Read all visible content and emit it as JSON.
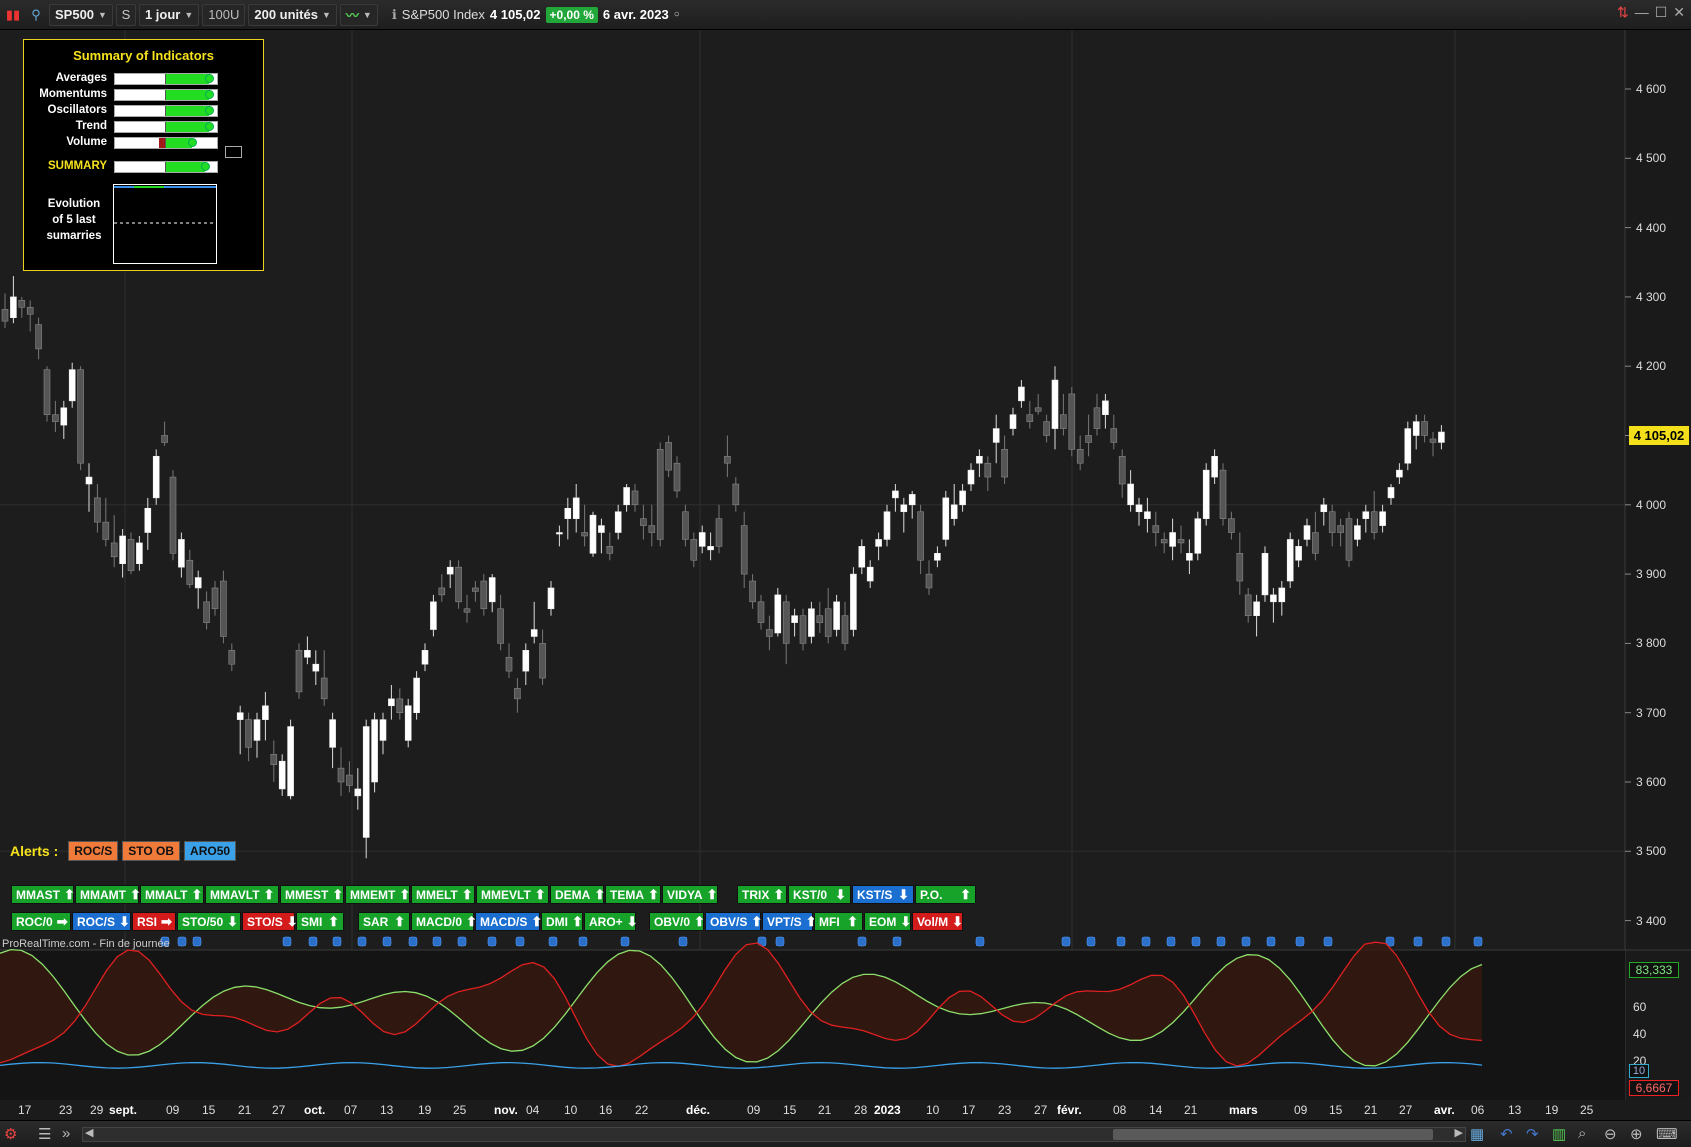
{
  "toolbar": {
    "symbol": "SP500",
    "s_label": "S",
    "period": "1 jour",
    "units_btn": "100U",
    "units": "200 unités",
    "instrument_name": "S&P500 Index",
    "last_value": "4 105,02",
    "change_pct": "+0,00 %",
    "date": "6 avr. 2023"
  },
  "summary_panel": {
    "title": "Summary of Indicators",
    "rows": [
      {
        "label": "Averages",
        "level": 0.92,
        "negative": 0
      },
      {
        "label": "Momentums",
        "level": 0.92,
        "negative": 0
      },
      {
        "label": "Oscillators",
        "level": 0.92,
        "negative": 0
      },
      {
        "label": "Trend",
        "level": 0.92,
        "negative": 0
      },
      {
        "label": "Volume",
        "level": 0.75,
        "negative": 0.07
      }
    ],
    "summary": {
      "label": "SUMMARY",
      "level": 0.88,
      "negative": 0
    },
    "evolution_label": "Evolution of 5 last sumarries"
  },
  "price_axis": [
    "4 600",
    "4 500",
    "4 400",
    "4 300",
    "4 200",
    "4 100",
    "4 000",
    "3 900",
    "3 800",
    "3 700",
    "3 600",
    "3 500",
    "3 400"
  ],
  "last_price_badge": "4 105,02",
  "alerts": {
    "title": "Alerts :",
    "tags": [
      {
        "label": "ROC/S",
        "color": "#f07a3a"
      },
      {
        "label": "STO OB",
        "color": "#f07a3a"
      },
      {
        "label": "ARO50",
        "color": "#3aa0e8"
      }
    ]
  },
  "badges_row1": [
    {
      "label": "MMAST",
      "arrow": "up",
      "color": "g"
    },
    {
      "label": "MMAMT",
      "arrow": "up",
      "color": "g"
    },
    {
      "label": "MMALT",
      "arrow": "up",
      "color": "g"
    },
    {
      "label": "MMAVLT",
      "arrow": "up",
      "color": "g"
    },
    {
      "label": "MMEST",
      "arrow": "up",
      "color": "g"
    },
    {
      "label": "MMEMT",
      "arrow": "up",
      "color": "g"
    },
    {
      "label": "MMELT",
      "arrow": "up",
      "color": "g"
    },
    {
      "label": "MMEVLT",
      "arrow": "up",
      "color": "g"
    },
    {
      "label": "DEMA",
      "arrow": "up",
      "color": "g"
    },
    {
      "label": "TEMA",
      "arrow": "up",
      "color": "g"
    },
    {
      "label": "VIDYA",
      "arrow": "up",
      "color": "g"
    },
    {
      "label": "TRIX",
      "arrow": "up",
      "color": "g"
    },
    {
      "label": "KST/0",
      "arrow": "down",
      "color": "g"
    },
    {
      "label": "KST/S",
      "arrow": "down",
      "color": "b"
    },
    {
      "label": "P.O.",
      "arrow": "up",
      "color": "g"
    }
  ],
  "badges_row2": [
    {
      "label": "ROC/0",
      "arrow": "right",
      "color": "g"
    },
    {
      "label": "ROC/S",
      "arrow": "down",
      "color": "b"
    },
    {
      "label": "RSI",
      "arrow": "right",
      "color": "r"
    },
    {
      "label": "STO/50",
      "arrow": "down",
      "color": "g"
    },
    {
      "label": "STO/S",
      "arrow": "down",
      "color": "r"
    },
    {
      "label": "SMI",
      "arrow": "up",
      "color": "g"
    },
    {
      "label": "SAR",
      "arrow": "up",
      "color": "g"
    },
    {
      "label": "MACD/0",
      "arrow": "up",
      "color": "g"
    },
    {
      "label": "MACD/S",
      "arrow": "up",
      "color": "b"
    },
    {
      "label": "DMI",
      "arrow": "up",
      "color": "g"
    },
    {
      "label": "ARO+",
      "arrow": "down",
      "color": "g"
    },
    {
      "label": "OBV/0",
      "arrow": "up",
      "color": "g"
    },
    {
      "label": "OBV/S",
      "arrow": "up",
      "color": "b"
    },
    {
      "label": "VPT/S",
      "arrow": "up",
      "color": "b"
    },
    {
      "label": "MFI",
      "arrow": "up",
      "color": "g"
    },
    {
      "label": "EOM",
      "arrow": "down",
      "color": "g"
    },
    {
      "label": "Vol/M",
      "arrow": "down",
      "color": "r"
    }
  ],
  "footer_note": "ProRealTime.com - Fin de journée",
  "oscillator_axis": [
    "60",
    "40",
    "20"
  ],
  "oscillator_values": {
    "top": "83,333",
    "mid": "10",
    "bottom": "6,6667"
  },
  "date_axis": [
    {
      "label": "17",
      "major": false
    },
    {
      "label": "23",
      "major": false
    },
    {
      "label": "29",
      "major": false
    },
    {
      "label": "sept.",
      "major": true
    },
    {
      "label": "09",
      "major": false
    },
    {
      "label": "15",
      "major": false
    },
    {
      "label": "21",
      "major": false
    },
    {
      "label": "27",
      "major": false
    },
    {
      "label": "oct.",
      "major": true
    },
    {
      "label": "07",
      "major": false
    },
    {
      "label": "13",
      "major": false
    },
    {
      "label": "19",
      "major": false
    },
    {
      "label": "25",
      "major": false
    },
    {
      "label": "nov.",
      "major": true
    },
    {
      "label": "04",
      "major": false
    },
    {
      "label": "10",
      "major": false
    },
    {
      "label": "16",
      "major": false
    },
    {
      "label": "22",
      "major": false
    },
    {
      "label": "déc.",
      "major": true
    },
    {
      "label": "09",
      "major": false
    },
    {
      "label": "15",
      "major": false
    },
    {
      "label": "21",
      "major": false
    },
    {
      "label": "28",
      "major": false
    },
    {
      "label": "2023",
      "major": true
    },
    {
      "label": "10",
      "major": false
    },
    {
      "label": "17",
      "major": false
    },
    {
      "label": "23",
      "major": false
    },
    {
      "label": "27",
      "major": false
    },
    {
      "label": "févr.",
      "major": true
    },
    {
      "label": "08",
      "major": false
    },
    {
      "label": "14",
      "major": false
    },
    {
      "label": "21",
      "major": false
    },
    {
      "label": "mars",
      "major": true
    },
    {
      "label": "09",
      "major": false
    },
    {
      "label": "15",
      "major": false
    },
    {
      "label": "21",
      "major": false
    },
    {
      "label": "27",
      "major": false
    },
    {
      "label": "avr.",
      "major": true
    },
    {
      "label": "06",
      "major": false
    },
    {
      "label": "13",
      "major": false
    },
    {
      "label": "19",
      "major": false
    },
    {
      "label": "25",
      "major": false
    }
  ],
  "colors": {
    "background": "#1b1b1b",
    "accent_yellow": "#f3e01b",
    "up_candle": "#ffffff",
    "down_candle": "#555555",
    "osc_green": "#8ddf6a",
    "osc_red": "#e02020",
    "osc_blue": "#3aa0e8"
  },
  "icons": [
    "chart-type-icon",
    "indicator-icon",
    "info-icon",
    "sync-icon",
    "minimize-icon",
    "maximize-icon",
    "close-icon",
    "menu-icon",
    "calendar-icon",
    "undo-icon",
    "redo-icon",
    "zoom-in-icon",
    "zoom-out-icon"
  ],
  "chart_data": {
    "type": "candlestick",
    "ylim": [
      3350,
      4680
    ],
    "candles": [
      [
        4282,
        4305,
        4255,
        4265
      ],
      [
        4270,
        4330,
        4262,
        4300
      ],
      [
        4295,
        4300,
        4270,
        4285
      ],
      [
        4285,
        4295,
        4250,
        4275
      ],
      [
        4260,
        4270,
        4210,
        4225
      ],
      [
        4195,
        4200,
        4120,
        4130
      ],
      [
        4130,
        4150,
        4105,
        4120
      ],
      [
        4115,
        4150,
        4095,
        4140
      ],
      [
        4150,
        4205,
        4140,
        4195
      ],
      [
        4195,
        4200,
        4050,
        4060
      ],
      [
        4030,
        4060,
        3990,
        4040
      ],
      [
        4010,
        4030,
        3960,
        3975
      ],
      [
        3975,
        4010,
        3940,
        3950
      ],
      [
        3945,
        3985,
        3910,
        3925
      ],
      [
        3915,
        3965,
        3895,
        3955
      ],
      [
        3950,
        3960,
        3900,
        3905
      ],
      [
        3915,
        3955,
        3905,
        3945
      ],
      [
        3960,
        4010,
        3935,
        3995
      ],
      [
        4010,
        4080,
        4000,
        4070
      ],
      [
        4100,
        4120,
        4085,
        4090
      ],
      [
        4040,
        4050,
        3920,
        3930
      ],
      [
        3910,
        3960,
        3895,
        3950
      ],
      [
        3920,
        3935,
        3880,
        3885
      ],
      [
        3880,
        3905,
        3850,
        3895
      ],
      [
        3860,
        3875,
        3820,
        3830
      ],
      [
        3880,
        3890,
        3840,
        3850
      ],
      [
        3890,
        3905,
        3800,
        3810
      ],
      [
        3790,
        3800,
        3760,
        3770
      ],
      [
        3690,
        3710,
        3640,
        3700
      ],
      [
        3690,
        3700,
        3630,
        3650
      ],
      [
        3660,
        3700,
        3635,
        3690
      ],
      [
        3690,
        3730,
        3660,
        3710
      ],
      [
        3640,
        3660,
        3600,
        3625
      ],
      [
        3590,
        3640,
        3580,
        3630
      ],
      [
        3580,
        3690,
        3575,
        3680
      ],
      [
        3790,
        3800,
        3720,
        3730
      ],
      [
        3780,
        3810,
        3770,
        3790
      ],
      [
        3760,
        3790,
        3740,
        3770
      ],
      [
        3750,
        3790,
        3710,
        3720
      ],
      [
        3650,
        3700,
        3620,
        3690
      ],
      [
        3620,
        3650,
        3580,
        3600
      ],
      [
        3610,
        3630,
        3585,
        3595
      ],
      [
        3580,
        3620,
        3560,
        3590
      ],
      [
        3520,
        3690,
        3490,
        3680
      ],
      [
        3600,
        3700,
        3585,
        3690
      ],
      [
        3660,
        3700,
        3640,
        3690
      ],
      [
        3710,
        3740,
        3690,
        3720
      ],
      [
        3720,
        3735,
        3690,
        3700
      ],
      [
        3660,
        3720,
        3650,
        3710
      ],
      [
        3700,
        3760,
        3690,
        3750
      ],
      [
        3770,
        3800,
        3760,
        3790
      ],
      [
        3820,
        3870,
        3810,
        3860
      ],
      [
        3880,
        3900,
        3860,
        3870
      ],
      [
        3900,
        3920,
        3880,
        3910
      ],
      [
        3910,
        3920,
        3850,
        3860
      ],
      [
        3850,
        3870,
        3830,
        3845
      ],
      [
        3880,
        3890,
        3860,
        3875
      ],
      [
        3890,
        3900,
        3840,
        3850
      ],
      [
        3860,
        3900,
        3845,
        3895
      ],
      [
        3850,
        3870,
        3790,
        3800
      ],
      [
        3780,
        3800,
        3750,
        3760
      ],
      [
        3735,
        3750,
        3700,
        3720
      ],
      [
        3760,
        3800,
        3740,
        3790
      ],
      [
        3810,
        3860,
        3800,
        3820
      ],
      [
        3800,
        3820,
        3740,
        3750
      ],
      [
        3850,
        3890,
        3840,
        3880
      ],
      [
        3960,
        3970,
        3940,
        3960
      ],
      [
        3980,
        4010,
        3950,
        3995
      ],
      [
        3980,
        4030,
        3960,
        4010
      ],
      [
        3960,
        4000,
        3940,
        3955
      ],
      [
        3930,
        3990,
        3925,
        3985
      ],
      [
        3960,
        3980,
        3930,
        3970
      ],
      [
        3940,
        3960,
        3920,
        3930
      ],
      [
        3960,
        4000,
        3950,
        3990
      ],
      [
        4000,
        4030,
        3990,
        4025
      ],
      [
        4020,
        4030,
        3990,
        4000
      ],
      [
        3980,
        4000,
        3950,
        3970
      ],
      [
        3970,
        4000,
        3940,
        3960
      ],
      [
        4080,
        4090,
        3940,
        3950
      ],
      [
        4090,
        4100,
        4040,
        4050
      ],
      [
        4060,
        4070,
        4010,
        4020
      ],
      [
        3990,
        4000,
        3940,
        3950
      ],
      [
        3950,
        3960,
        3910,
        3920
      ],
      [
        3940,
        3970,
        3930,
        3960
      ],
      [
        3935,
        3960,
        3920,
        3940
      ],
      [
        3980,
        4000,
        3930,
        3940
      ],
      [
        4070,
        4100,
        4040,
        4060
      ],
      [
        4030,
        4040,
        3990,
        4000
      ],
      [
        3970,
        3990,
        3880,
        3900
      ],
      [
        3890,
        3900,
        3850,
        3860
      ],
      [
        3860,
        3870,
        3820,
        3830
      ],
      [
        3820,
        3840,
        3790,
        3810
      ],
      [
        3815,
        3880,
        3810,
        3870
      ],
      [
        3860,
        3870,
        3770,
        3800
      ],
      [
        3830,
        3850,
        3810,
        3840
      ],
      [
        3840,
        3850,
        3790,
        3800
      ],
      [
        3810,
        3860,
        3800,
        3850
      ],
      [
        3840,
        3860,
        3815,
        3830
      ],
      [
        3850,
        3880,
        3800,
        3810
      ],
      [
        3820,
        3870,
        3810,
        3860
      ],
      [
        3840,
        3860,
        3790,
        3800
      ],
      [
        3820,
        3910,
        3810,
        3900
      ],
      [
        3910,
        3950,
        3900,
        3940
      ],
      [
        3890,
        3920,
        3880,
        3910
      ],
      [
        3940,
        3960,
        3920,
        3950
      ],
      [
        3950,
        4000,
        3940,
        3990
      ],
      [
        4010,
        4030,
        3990,
        4020
      ],
      [
        3990,
        4010,
        3960,
        4000
      ],
      [
        4000,
        4020,
        3980,
        4015
      ],
      [
        3990,
        4000,
        3900,
        3920
      ],
      [
        3900,
        3920,
        3870,
        3880
      ],
      [
        3920,
        3940,
        3910,
        3930
      ],
      [
        3950,
        4020,
        3940,
        4010
      ],
      [
        3980,
        4030,
        3970,
        4000
      ],
      [
        4000,
        4030,
        3990,
        4020
      ],
      [
        4030,
        4060,
        4020,
        4050
      ],
      [
        4060,
        4080,
        4040,
        4070
      ],
      [
        4060,
        4070,
        4020,
        4040
      ],
      [
        4090,
        4130,
        4060,
        4110
      ],
      [
        4080,
        4100,
        4030,
        4040
      ],
      [
        4110,
        4140,
        4100,
        4130
      ],
      [
        4150,
        4180,
        4140,
        4170
      ],
      [
        4130,
        4150,
        4110,
        4120
      ],
      [
        4140,
        4160,
        4130,
        4135
      ],
      [
        4120,
        4130,
        4090,
        4100
      ],
      [
        4110,
        4200,
        4080,
        4180
      ],
      [
        4130,
        4160,
        4100,
        4110
      ],
      [
        4160,
        4170,
        4070,
        4080
      ],
      [
        4080,
        4100,
        4050,
        4060
      ],
      [
        4100,
        4130,
        4070,
        4090
      ],
      [
        4140,
        4160,
        4100,
        4110
      ],
      [
        4130,
        4160,
        4110,
        4150
      ],
      [
        4110,
        4130,
        4080,
        4090
      ],
      [
        4070,
        4080,
        4010,
        4030
      ],
      [
        4000,
        4050,
        3990,
        4030
      ],
      [
        3990,
        4010,
        3970,
        4000
      ],
      [
        3980,
        4010,
        3960,
        3990
      ],
      [
        3970,
        3990,
        3940,
        3960
      ],
      [
        3950,
        3960,
        3930,
        3945
      ],
      [
        3940,
        3980,
        3920,
        3960
      ],
      [
        3950,
        3970,
        3930,
        3945
      ],
      [
        3920,
        3950,
        3900,
        3930
      ],
      [
        3930,
        3990,
        3920,
        3980
      ],
      [
        3980,
        4060,
        3970,
        4050
      ],
      [
        4040,
        4080,
        4030,
        4070
      ],
      [
        4050,
        4060,
        3970,
        3980
      ],
      [
        3980,
        3990,
        3950,
        3960
      ],
      [
        3930,
        3960,
        3870,
        3890
      ],
      [
        3870,
        3880,
        3830,
        3840
      ],
      [
        3840,
        3870,
        3810,
        3860
      ],
      [
        3870,
        3940,
        3860,
        3930
      ],
      [
        3860,
        3880,
        3830,
        3870
      ],
      [
        3860,
        3890,
        3840,
        3880
      ],
      [
        3890,
        3960,
        3880,
        3950
      ],
      [
        3920,
        3950,
        3910,
        3940
      ],
      [
        3950,
        3980,
        3940,
        3970
      ],
      [
        3960,
        3990,
        3920,
        3930
      ],
      [
        3990,
        4010,
        3970,
        4000
      ],
      [
        3990,
        4000,
        3940,
        3960
      ],
      [
        3970,
        3980,
        3940,
        3960
      ],
      [
        3980,
        3990,
        3910,
        3920
      ],
      [
        3950,
        3980,
        3940,
        3970
      ],
      [
        3980,
        4000,
        3960,
        3990
      ],
      [
        3990,
        4020,
        3950,
        3960
      ],
      [
        3970,
        4000,
        3960,
        3990
      ],
      [
        4010,
        4030,
        4000,
        4025
      ],
      [
        4040,
        4060,
        4030,
        4050
      ],
      [
        4060,
        4120,
        4050,
        4110
      ],
      [
        4100,
        4130,
        4080,
        4120
      ],
      [
        4120,
        4130,
        4090,
        4100
      ],
      [
        4095,
        4105,
        4070,
        4090
      ],
      [
        4090,
        4115,
        4080,
        4105
      ]
    ]
  }
}
